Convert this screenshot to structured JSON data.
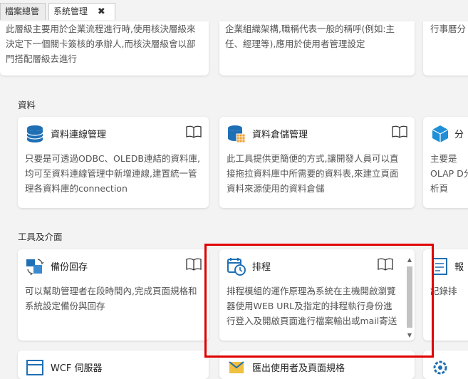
{
  "tabs": [
    {
      "label": "檔案總管"
    },
    {
      "label": "系統管理",
      "close": "✖"
    }
  ],
  "top_cards": [
    {
      "desc": "此層級主要用於企業流程進行時,使用核決層級來決定下一個關卡簽核的承辦人,而核決層級會以部門搭配層級去進行"
    },
    {
      "desc": "企業組織架構,職稱代表一般的稱呼(例如:主任、經理等),應用於使用者管理設定"
    },
    {
      "desc": "行事曆分"
    }
  ],
  "sections": {
    "data": {
      "label": "資料",
      "cards": [
        {
          "title": "資料連線管理",
          "desc": "只要是可透過ODBC、OLEDB連結的資料庫,均可至資料連線管理中新增連線,建置統一管理各資料庫的connection"
        },
        {
          "title": "資料倉儲管理",
          "desc": "此工具提供更簡便的方式,讓開發人員可以直接拖拉資料庫中所需要的資料表,來建立頁面資料來源使用的資料倉儲"
        },
        {
          "title": "分",
          "desc": "主要是OLAP D分析頁"
        }
      ]
    },
    "tools": {
      "label": "工具及介面",
      "cards": [
        {
          "title": "備份回存",
          "desc": "可以幫助管理者在段時間內,完成頁面規格和系統設定備份與回存"
        },
        {
          "title": "排程",
          "desc": "排程模組的運作原理為系統在主機開啟瀏覽器使用WEB URL及指定的排程執行身份進行登入及開啟頁面進行檔案輸出或mail寄送"
        },
        {
          "title": "報",
          "desc": "記錄排"
        }
      ]
    },
    "bottom": {
      "cards": [
        {
          "title": "WCF 伺服器"
        },
        {
          "title": "匯出使用者及頁面規格"
        }
      ]
    }
  },
  "scrollbar": {
    "up": "▲",
    "down": "▼"
  },
  "colors": {
    "highlight": "#e00000",
    "icon_blue": "#1f6fb5"
  }
}
